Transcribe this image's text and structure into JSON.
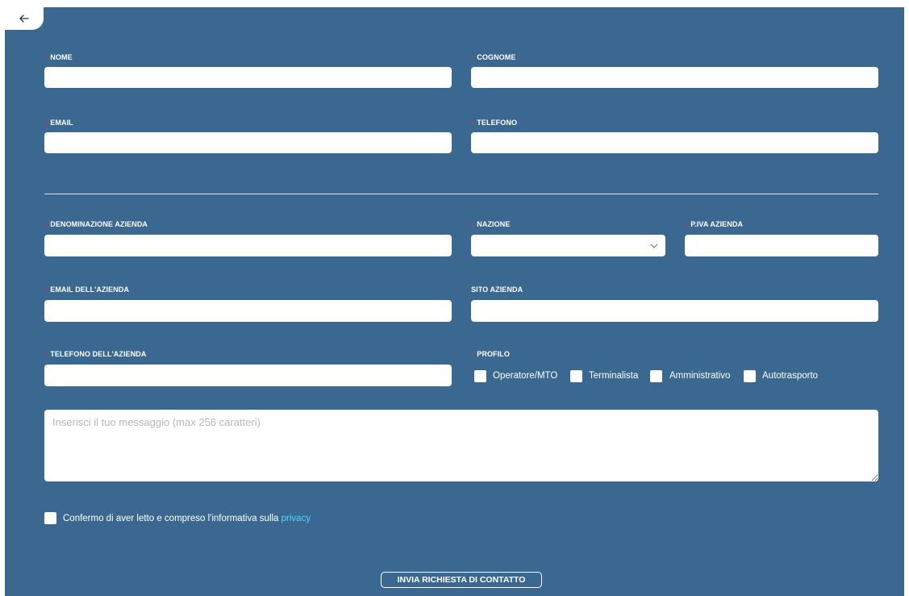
{
  "back_button": {
    "icon": "arrow-left-icon"
  },
  "personal": {
    "nome": {
      "label": "NOME",
      "required": true,
      "value": ""
    },
    "cognome": {
      "label": "COGNOME",
      "required": true,
      "value": ""
    },
    "email": {
      "label": "EMAIL",
      "required": true,
      "value": ""
    },
    "telefono": {
      "label": "TELEFONO",
      "required": true,
      "value": ""
    }
  },
  "company": {
    "denominazione": {
      "label": "DENOMINAZIONE AZIENDA",
      "required": true,
      "value": ""
    },
    "nazione": {
      "label": "NAZIONE",
      "required": true,
      "selected": ""
    },
    "piva": {
      "label": "P.IVA AZIENDA",
      "required": true,
      "value": ""
    },
    "email": {
      "label": "EMAIL DELL'AZIENDA",
      "required": true,
      "value": ""
    },
    "sito": {
      "label": "SITO AZIENDA",
      "required": false,
      "value": ""
    },
    "telefono": {
      "label": "TELEFONO DELL'AZIENDA",
      "required": true,
      "value": ""
    }
  },
  "profilo": {
    "label": "PROFILO",
    "required": true,
    "options": [
      {
        "label": "Operatore/MTO",
        "checked": false
      },
      {
        "label": "Terminalista",
        "checked": false
      },
      {
        "label": "Amministrativo",
        "checked": false
      },
      {
        "label": "Autotrasporto",
        "checked": false
      }
    ]
  },
  "message": {
    "placeholder": "Inserisci il tuo messaggio (max 256 caratteri)",
    "value": ""
  },
  "privacy": {
    "text": "Confermo di aver letto e compreso l'informativa sulla ",
    "link": "privacy",
    "checked": false
  },
  "submit": {
    "label": "INVIA RICHIESTA DI CONTATTO"
  },
  "colors": {
    "background": "#3b6891",
    "required_marker": "#d0324a",
    "link": "#4fd3ff"
  }
}
